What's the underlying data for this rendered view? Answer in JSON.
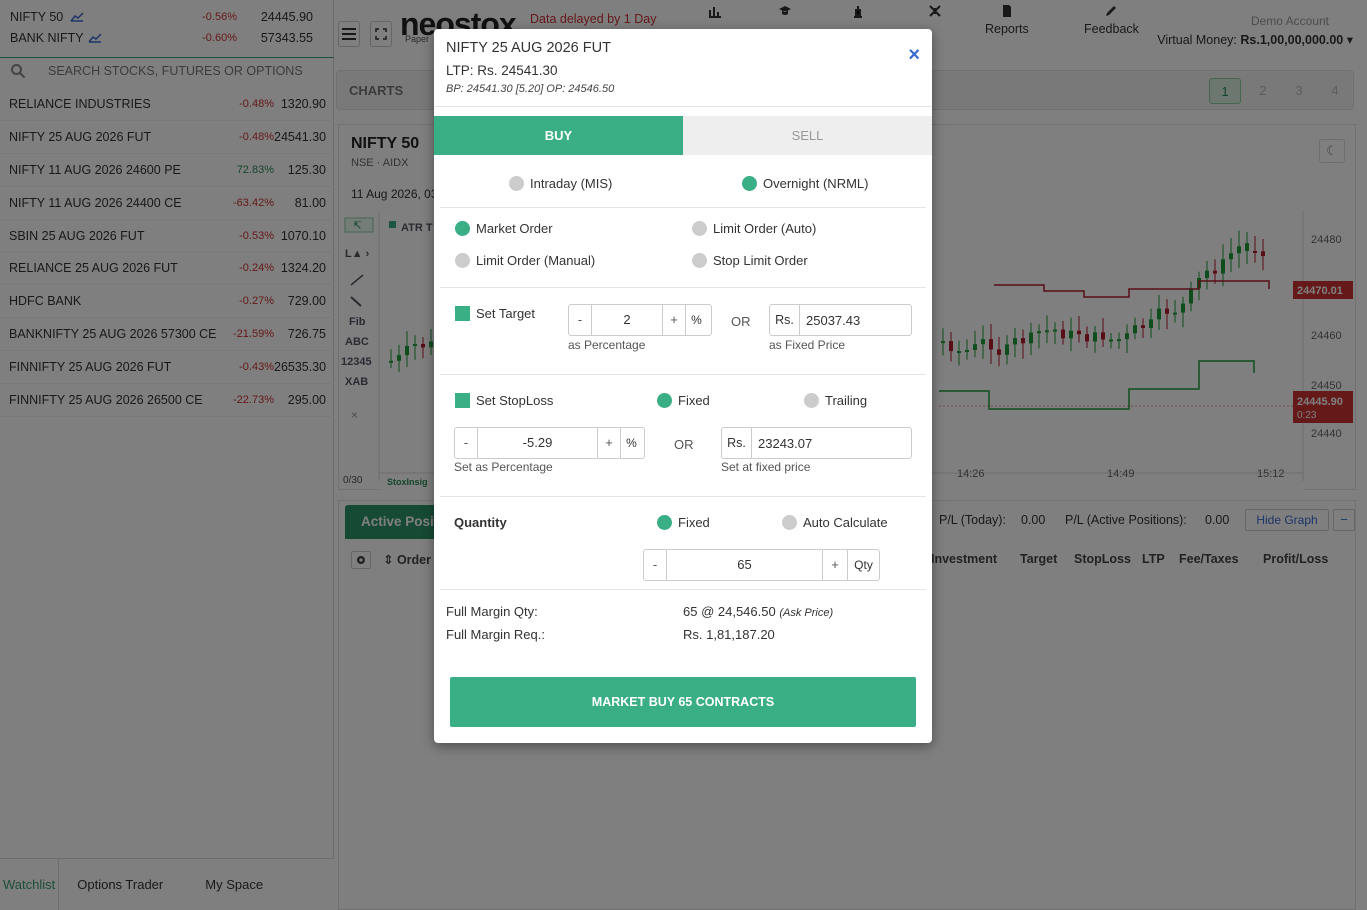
{
  "indices": [
    {
      "name": "NIFTY 50",
      "change": "-0.56%",
      "ltp": "24445.90"
    },
    {
      "name": "BANK NIFTY",
      "change": "-0.60%",
      "ltp": "57343.55"
    }
  ],
  "search": {
    "placeholder": "SEARCH STOCKS, FUTURES OR OPTIONS"
  },
  "watchlist": [
    {
      "name": "RELIANCE INDUSTRIES",
      "change": "-0.48%",
      "ltp": "1320.90",
      "dir": "neg"
    },
    {
      "name": "NIFTY 25 AUG 2026 FUT",
      "change": "-0.48%",
      "ltp": "24541.30",
      "dir": "neg"
    },
    {
      "name": "NIFTY 11 AUG 2026 24600 PE",
      "change": "72.83%",
      "ltp": "125.30",
      "dir": "pos"
    },
    {
      "name": "NIFTY 11 AUG 2026 24400 CE",
      "change": "-63.42%",
      "ltp": "81.00",
      "dir": "neg"
    },
    {
      "name": "SBIN 25 AUG 2026 FUT",
      "change": "-0.53%",
      "ltp": "1070.10",
      "dir": "neg"
    },
    {
      "name": "RELIANCE 25 AUG 2026 FUT",
      "change": "-0.24%",
      "ltp": "1324.20",
      "dir": "neg"
    },
    {
      "name": "HDFC BANK",
      "change": "-0.27%",
      "ltp": "729.00",
      "dir": "neg"
    },
    {
      "name": "BANKNIFTY 25 AUG 2026 57300 CE",
      "change": "-21.59%",
      "ltp": "726.75",
      "dir": "neg"
    },
    {
      "name": "FINNIFTY 25 AUG 2026 FUT",
      "change": "-0.43%",
      "ltp": "26535.30",
      "dir": "neg"
    },
    {
      "name": "FINNIFTY 25 AUG 2026 26500 CE",
      "change": "-22.73%",
      "ltp": "295.00",
      "dir": "neg"
    }
  ],
  "bottom_tabs": [
    "Watchlist",
    "Options Trader",
    "My Space"
  ],
  "topbar": {
    "logo": "neostox",
    "logo_sub": "Paper",
    "delayed": "Data delayed by 1 Day",
    "nav": [
      "Reports",
      "Feedback"
    ],
    "account": "Demo Account",
    "virtual_money_label": "Virtual Money: ",
    "virtual_money_value": "Rs.1,00,00,000.00"
  },
  "charts": {
    "label": "CHARTS",
    "pages": [
      "1",
      "2",
      "3",
      "4"
    ],
    "symbol": "NIFTY 50",
    "exchange": "NSE · AIDX",
    "date": "11 Aug 2026, 03",
    "indicator": "ATR T",
    "price_ticks": [
      "24480",
      "24460",
      "24450",
      "24440"
    ],
    "time_ticks": [
      "14:26",
      "14:49",
      "15:12"
    ],
    "tag_high": "24470.01",
    "tag_last": "24445.90",
    "tag_last_time": "0:23",
    "tools": [
      "Fib",
      "ABC",
      "12345",
      "XAB"
    ],
    "counter": "0/30",
    "watermark": "StoxInsig"
  },
  "positions": {
    "tab": "Active Positions",
    "pl_today_label": "P/L (Today):",
    "pl_today": "0.00",
    "pl_active_label": "P/L (Active Positions):",
    "pl_active": "0.00",
    "hide_graph": "Hide Graph",
    "headers": [
      "Order",
      "Investment",
      "Target",
      "StopLoss",
      "LTP",
      "Fee/Taxes",
      "Profit/Loss"
    ]
  },
  "modal": {
    "title": "NIFTY 25 AUG 2026 FUT",
    "ltp": "LTP: Rs. 24541.30",
    "bp_op": "BP: 24541.30 [5.20] OP: 24546.50",
    "close": "×",
    "tabs": {
      "buy": "BUY",
      "sell": "SELL"
    },
    "product": {
      "intraday": "Intraday (MIS)",
      "overnight": "Overnight (NRML)"
    },
    "order_types": {
      "market": "Market Order",
      "limit_auto": "Limit Order (Auto)",
      "limit_manual": "Limit Order (Manual)",
      "stop_limit": "Stop Limit Order"
    },
    "target": {
      "label": "Set Target",
      "minus": "-",
      "plus": "+",
      "unit": "%",
      "pct_value": "2",
      "pct_hint": "as Percentage",
      "or": "OR",
      "price_unit": "Rs.",
      "price_value": "25037.43",
      "price_hint": "as Fixed Price"
    },
    "stoploss": {
      "label": "Set StopLoss",
      "fixed": "Fixed",
      "trailing": "Trailing",
      "minus": "-",
      "plus": "+",
      "unit": "%",
      "pct_value": "-5.29",
      "pct_hint": "Set as Percentage",
      "or": "OR",
      "price_unit": "Rs.",
      "price_value": "23243.07",
      "price_hint": "Set at fixed price"
    },
    "quantity": {
      "label": "Quantity",
      "fixed": "Fixed",
      "auto": "Auto Calculate",
      "minus": "-",
      "plus": "+",
      "unit": "Qty",
      "value": "65"
    },
    "margin": {
      "qty_label": "Full Margin Qty:",
      "qty_value": "65 @ 24,546.50",
      "qty_note": "(Ask Price)",
      "req_label": "Full Margin Req.:",
      "req_value": "Rs. 1,81,187.20"
    },
    "submit": "MARKET BUY 65 CONTRACTS"
  },
  "colors": {
    "accent": "#3aaf86",
    "negative": "#cc3333",
    "positive": "#2a8a5a",
    "link": "#3a6bd0"
  }
}
